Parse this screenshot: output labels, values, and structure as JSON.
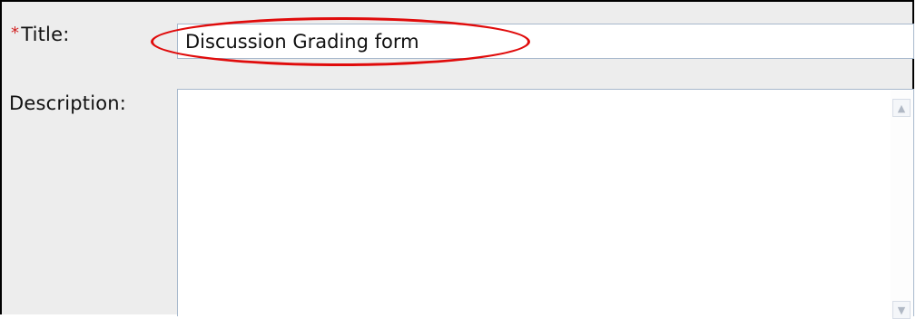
{
  "form": {
    "title": {
      "required_marker": "*",
      "label": "Title:",
      "value": "Discussion Grading form"
    },
    "description": {
      "label": "Description:",
      "value": ""
    }
  },
  "icons": {
    "scroll_up": "scroll-up-arrow-icon",
    "scroll_down": "scroll-down-arrow-icon"
  },
  "colors": {
    "required_marker": "#d12020",
    "highlight_circle": "#e00b0b",
    "input_border": "#a7b8cc",
    "panel_background": "#ededed"
  }
}
